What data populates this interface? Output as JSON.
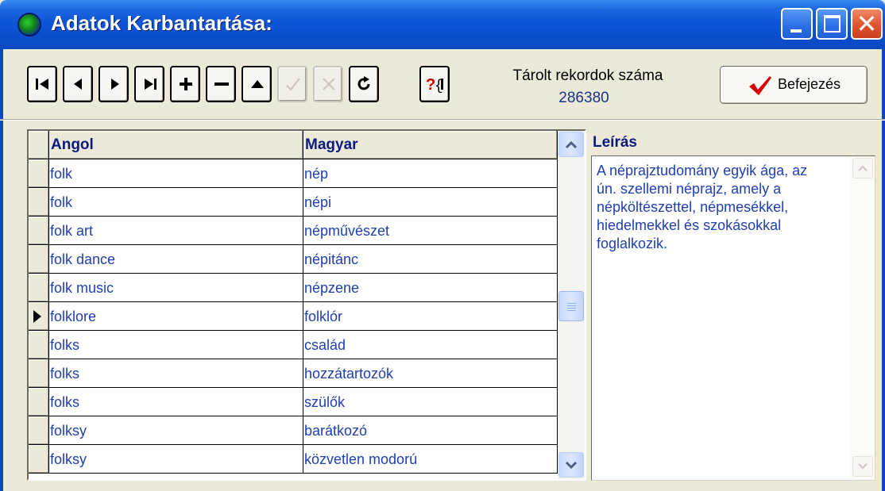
{
  "window": {
    "title": "Adatok Karbantartása:"
  },
  "toolbar": {
    "buttons": [
      {
        "name": "first-record-button",
        "disabled": false
      },
      {
        "name": "prior-record-button",
        "disabled": false
      },
      {
        "name": "next-record-button",
        "disabled": false
      },
      {
        "name": "last-record-button",
        "disabled": false
      },
      {
        "name": "insert-record-button",
        "disabled": false
      },
      {
        "name": "delete-record-button",
        "disabled": false
      },
      {
        "name": "edit-record-button",
        "disabled": false
      },
      {
        "name": "post-record-button",
        "disabled": true
      },
      {
        "name": "cancel-record-button",
        "disabled": true
      },
      {
        "name": "refresh-button",
        "disabled": false
      },
      {
        "name": "search-help-button",
        "disabled": false
      }
    ],
    "records_label": "Tárolt rekordok száma",
    "records_count": "286380",
    "finish_label": "Befejezés"
  },
  "grid": {
    "columns": [
      "Angol",
      "Magyar"
    ],
    "current_row": 5,
    "rows": [
      {
        "angol": "folk",
        "magyar": "nép"
      },
      {
        "angol": "folk",
        "magyar": "népi"
      },
      {
        "angol": "folk art",
        "magyar": "népművészet"
      },
      {
        "angol": "folk dance",
        "magyar": "népitánc"
      },
      {
        "angol": "folk music",
        "magyar": "népzene"
      },
      {
        "angol": "folklore",
        "magyar": "folklór"
      },
      {
        "angol": "folks",
        "magyar": "család"
      },
      {
        "angol": "folks",
        "magyar": "hozzátartozók"
      },
      {
        "angol": "folks",
        "magyar": "szülők"
      },
      {
        "angol": "folksy",
        "magyar": "barátkozó"
      },
      {
        "angol": "folksy",
        "magyar": "közvetlen modorú"
      }
    ]
  },
  "description": {
    "label": "Leírás",
    "text": "A néprajztudomány egyik ága, az\nún. szellemi néprajz, amely a\nnépköltészettel, népmesékkel,\nhiedelmekkel és szokásokkal\nfoglalkozik."
  },
  "colors": {
    "titlebar": "#0a4fcf",
    "grid_text": "#1f3fb0",
    "header_text": "#0b1a80",
    "finish_check": "#d40000"
  },
  "icons": {
    "first": "skip-first-icon",
    "prior": "triangle-left-icon",
    "next": "triangle-right-icon",
    "last": "skip-last-icon",
    "insert": "plus-icon",
    "delete": "minus-icon",
    "edit": "triangle-up-icon",
    "post": "check-icon",
    "cancel": "x-icon",
    "refresh": "refresh-icon",
    "help": "help-brace-icon",
    "finish": "checkmark-icon"
  }
}
